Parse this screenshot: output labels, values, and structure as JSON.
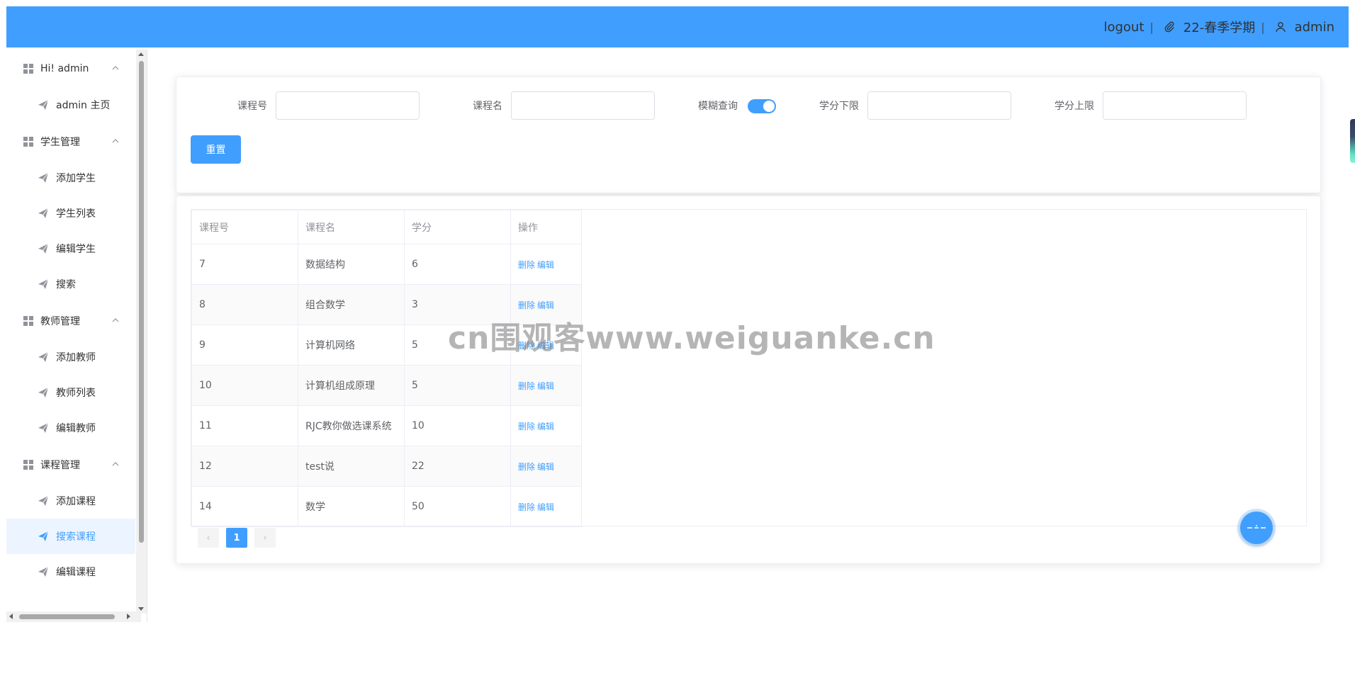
{
  "header": {
    "logout_label": "logout",
    "term_label": "22-春季学期",
    "user_label": "admin",
    "separator": "|"
  },
  "sidebar": {
    "groups": [
      {
        "title": "Hi! admin",
        "items": [
          {
            "label": "admin 主页"
          }
        ]
      },
      {
        "title": "学生管理",
        "items": [
          {
            "label": "添加学生"
          },
          {
            "label": "学生列表"
          },
          {
            "label": "编辑学生"
          },
          {
            "label": "搜索"
          }
        ]
      },
      {
        "title": "教师管理",
        "items": [
          {
            "label": "添加教师"
          },
          {
            "label": "教师列表"
          },
          {
            "label": "编辑教师"
          }
        ]
      },
      {
        "title": "课程管理",
        "items": [
          {
            "label": "添加课程"
          },
          {
            "label": "搜索课程",
            "active": true
          },
          {
            "label": "编辑课程"
          }
        ]
      }
    ]
  },
  "search": {
    "course_id_label": "课程号",
    "course_id_value": "",
    "course_name_label": "课程名",
    "course_name_value": "",
    "fuzzy_label": "模糊查询",
    "fuzzy_on": true,
    "credit_min_label": "学分下限",
    "credit_min_value": "",
    "credit_max_label": "学分上限",
    "credit_max_value": "",
    "reset_label": "重置"
  },
  "table": {
    "headers": [
      "课程号",
      "课程名",
      "学分",
      "操作"
    ],
    "rows": [
      {
        "id": "7",
        "name": "数据结构",
        "credit": "6"
      },
      {
        "id": "8",
        "name": "组合数学",
        "credit": "3"
      },
      {
        "id": "9",
        "name": "计算机网络",
        "credit": "5"
      },
      {
        "id": "10",
        "name": "计算机组成原理",
        "credit": "5"
      },
      {
        "id": "11",
        "name": "RJC教你做选课系统",
        "credit": "10"
      },
      {
        "id": "12",
        "name": "test说",
        "credit": "22"
      },
      {
        "id": "14",
        "name": "数学",
        "credit": "50"
      }
    ],
    "delete_label": "删除",
    "edit_label": "编辑"
  },
  "pagination": {
    "prev": "‹",
    "current": "1",
    "next": "›"
  },
  "watermark": "cn围观客www.weiguanke.cn",
  "colors": {
    "primary": "#409eff",
    "header_bg": "#409eff",
    "active_menu_bg": "#ecf5ff"
  }
}
